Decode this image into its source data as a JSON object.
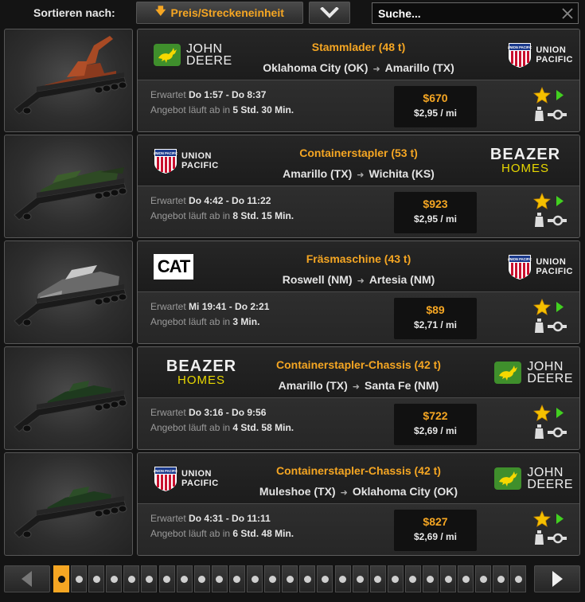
{
  "sort": {
    "label": "Sortieren nach:",
    "selected": "Preis/Streckeneinheit"
  },
  "search": {
    "placeholder": "Suche..."
  },
  "colors": {
    "accent": "#f5a623",
    "green": "#3f8f2c",
    "star": "#f5c000"
  },
  "jobs": [
    {
      "cargo": "Stammlader (48 t)",
      "from": "Oklahoma City (OK)",
      "to": "Amarillo (TX)",
      "source_logo": "john-deere",
      "target_logo": "union-pacific",
      "expected_label": "Erwartet",
      "expected_value": "Do 1:57 - Do 8:37",
      "ends_label": "Angebot läuft ab in",
      "ends_value": "5 Std. 30 Min.",
      "payment": "$670",
      "rate": "$2,95 / mi"
    },
    {
      "cargo": "Containerstapler (53 t)",
      "from": "Amarillo (TX)",
      "to": "Wichita (KS)",
      "source_logo": "union-pacific",
      "target_logo": "beazer-homes",
      "expected_label": "Erwartet",
      "expected_value": "Do 4:42 - Do 11:22",
      "ends_label": "Angebot läuft ab in",
      "ends_value": "8 Std. 15 Min.",
      "payment": "$923",
      "rate": "$2,95 / mi"
    },
    {
      "cargo": "Fräsmaschine (43 t)",
      "from": "Roswell (NM)",
      "to": "Artesia (NM)",
      "source_logo": "cat",
      "target_logo": "union-pacific",
      "expected_label": "Erwartet",
      "expected_value": "Mi 19:41 - Do 2:21",
      "ends_label": "Angebot läuft ab in",
      "ends_value": "3 Min.",
      "payment": "$89",
      "rate": "$2,71 / mi"
    },
    {
      "cargo": "Containerstapler-Chassis (42 t)",
      "from": "Amarillo (TX)",
      "to": "Santa Fe (NM)",
      "source_logo": "beazer-homes",
      "target_logo": "john-deere",
      "expected_label": "Erwartet",
      "expected_value": "Do 3:16 - Do 9:56",
      "ends_label": "Angebot läuft ab in",
      "ends_value": "4 Std. 58 Min.",
      "payment": "$722",
      "rate": "$2,69 / mi"
    },
    {
      "cargo": "Containerstapler-Chassis (42 t)",
      "from": "Muleshoe (TX)",
      "to": "Oklahoma City (OK)",
      "source_logo": "union-pacific",
      "target_logo": "john-deere",
      "expected_label": "Erwartet",
      "expected_value": "Do 4:31 - Do 11:11",
      "ends_label": "Angebot läuft ab in",
      "ends_value": "6 Std. 48 Min.",
      "payment": "$827",
      "rate": "$2,69 / mi"
    }
  ],
  "logos": {
    "john_deere": [
      "JOHN",
      "DEERE"
    ],
    "union_pacific": [
      "UNION",
      "PACIFIC"
    ],
    "union_pacific_shield": "UNION PACIFIC",
    "beazer": [
      "BEAZER",
      "HOMES"
    ],
    "cat": "CAT"
  },
  "pager": {
    "pages": 27,
    "current": 1
  }
}
